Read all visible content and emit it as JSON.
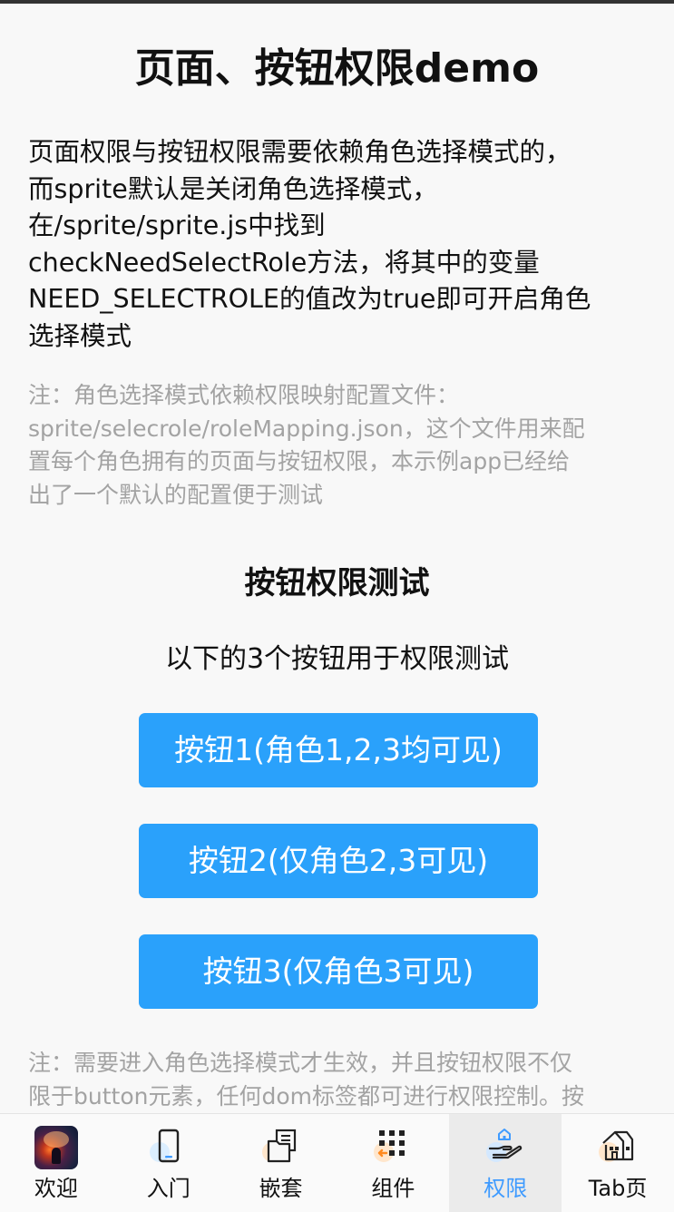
{
  "page": {
    "title": "页面、按钮权限demo",
    "intro_lines": [
      "页面权限与按钮权限需要依赖角色选择模式的，",
      "而sprite默认是关闭角色选择模式，",
      "在/sprite/sprite.js中找到",
      "checkNeedSelectRole方法，将其中的变量",
      "NEED_SELECTROLE的值改为true即可开启角色",
      "选择模式"
    ],
    "note_top_lines": [
      "注：角色选择模式依赖权限映射配置文件：",
      "sprite/selecrole/roleMapping.json，这个文件用来配",
      "置每个角色拥有的页面与按钮权限，本示例app已经给",
      "出了一个默认的配置便于测试"
    ]
  },
  "section": {
    "title": "按钮权限测试",
    "subtitle": "以下的3个按钮用于权限测试",
    "buttons": [
      "按钮1(角色1,2,3均可见)",
      "按钮2(仅角色2,3可见)",
      "按钮3(仅角色3可见)"
    ],
    "note_bottom_lines": [
      "注：需要进入角色选择模式才生效，并且按钮权限不仅",
      "限于button元素，任何dom标签都可进行权限控制。按"
    ]
  },
  "tabbar": {
    "active_index": 4,
    "accent_color": "#3f9bff",
    "button_color": "#2aa1fb",
    "items": [
      {
        "label": "欢迎",
        "icon": "avatar-image"
      },
      {
        "label": "入门",
        "icon": "phone-icon"
      },
      {
        "label": "嵌套",
        "icon": "folders-icon"
      },
      {
        "label": "组件",
        "icon": "grid-icon"
      },
      {
        "label": "权限",
        "icon": "hand-house-icon"
      },
      {
        "label": "Tab页",
        "icon": "house-icon"
      }
    ]
  }
}
